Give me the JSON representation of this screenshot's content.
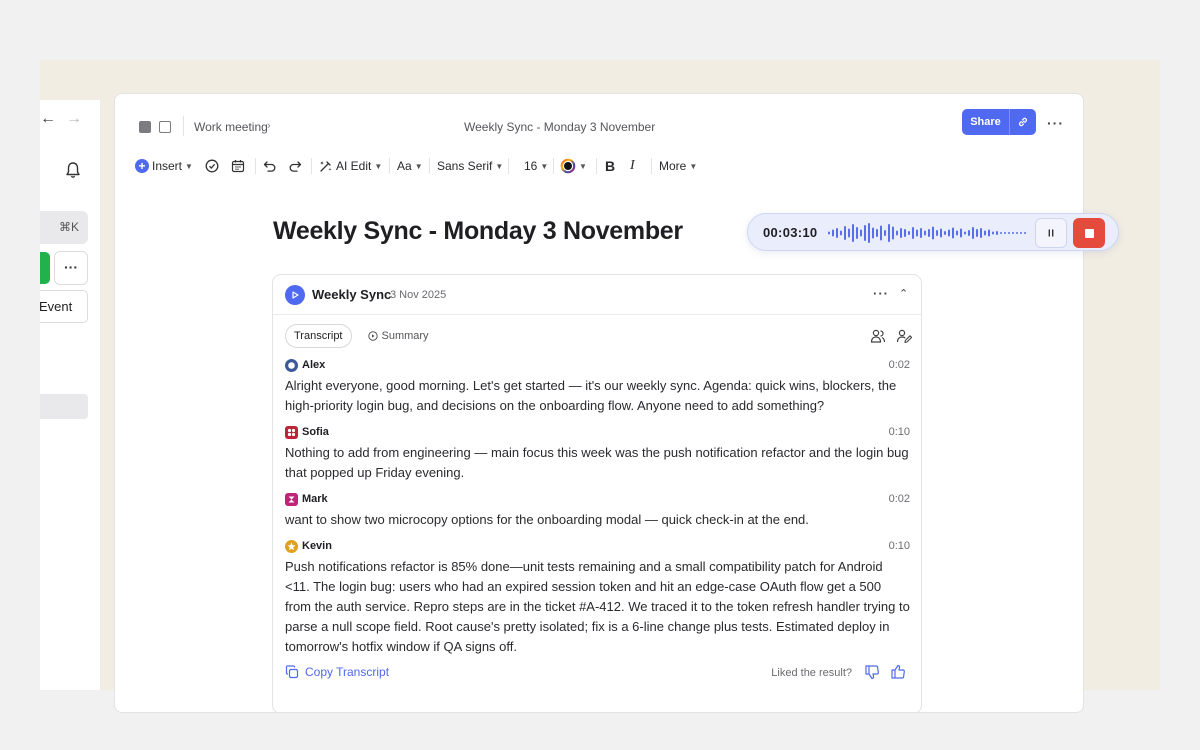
{
  "nav": {
    "back_icon": "arrow-left-icon",
    "forward_icon": "arrow-right-icon",
    "bell_icon": "bell-icon"
  },
  "sidebar": {
    "shortcut": "⌘K",
    "more_label": "···",
    "event_label": "Event"
  },
  "breadcrumb": {
    "item": "Work meeting",
    "chevron": "›"
  },
  "window_title": "Weekly Sync - Monday 3 November",
  "share": {
    "label": "Share",
    "link_icon": "link-icon",
    "accent": "#4f69f0"
  },
  "top_more": "···",
  "toolbar": {
    "insert": "Insert",
    "ai_edit": "AI Edit",
    "text_style": "Aa",
    "font": "Sans Serif",
    "font_size": "16",
    "more": "More",
    "bold": "B",
    "italic": "I"
  },
  "doc": {
    "heading": "Weekly Sync - Monday 3 November"
  },
  "recorder": {
    "time": "00:03:10",
    "pause_icon": "pause-icon",
    "stop_icon": "stop-icon",
    "stop_color": "#e54b3c"
  },
  "card": {
    "title": "Weekly Sync",
    "date": "3 Nov 2025",
    "more": "···",
    "collapse_chevron": "⌃",
    "tabs": {
      "transcript": "Transcript",
      "summary": "Summary"
    },
    "entries": [
      {
        "speaker": "Alex",
        "time": "0:02",
        "color": "#3b5b9a",
        "text": "Alright everyone, good morning. Let's get started — it's our weekly sync. Agenda: quick wins, blockers, the high-priority login bug, and decisions on the onboarding flow. Anyone need to add something?"
      },
      {
        "speaker": "Sofia",
        "time": "0:10",
        "color": "#c0223a",
        "text": "Nothing to add from engineering — main focus this week was the push notification refactor and the login bug that popped up Friday evening."
      },
      {
        "speaker": "Mark",
        "time": "0:02",
        "color": "#c0247a",
        "text": "want to show two microcopy options for the onboarding modal — quick check-in at the end."
      },
      {
        "speaker": "Kevin",
        "time": "0:10",
        "color": "#e0a020",
        "text": "Push notifications refactor is 85% done—unit tests remaining and a small compatibility patch for Android <11. The login bug: users who had an expired session token and hit an edge-case OAuth flow get a 500 from the auth service. Repro steps are in the ticket #A-412. We traced it to the token refresh handler trying to parse a null scope field. Root cause's pretty isolated; fix is a 6-line change plus tests. Estimated deploy in tomorrow's hotfix window if QA signs off."
      }
    ],
    "copy_label": "Copy Transcript",
    "feedback_label": "Liked the result?"
  }
}
